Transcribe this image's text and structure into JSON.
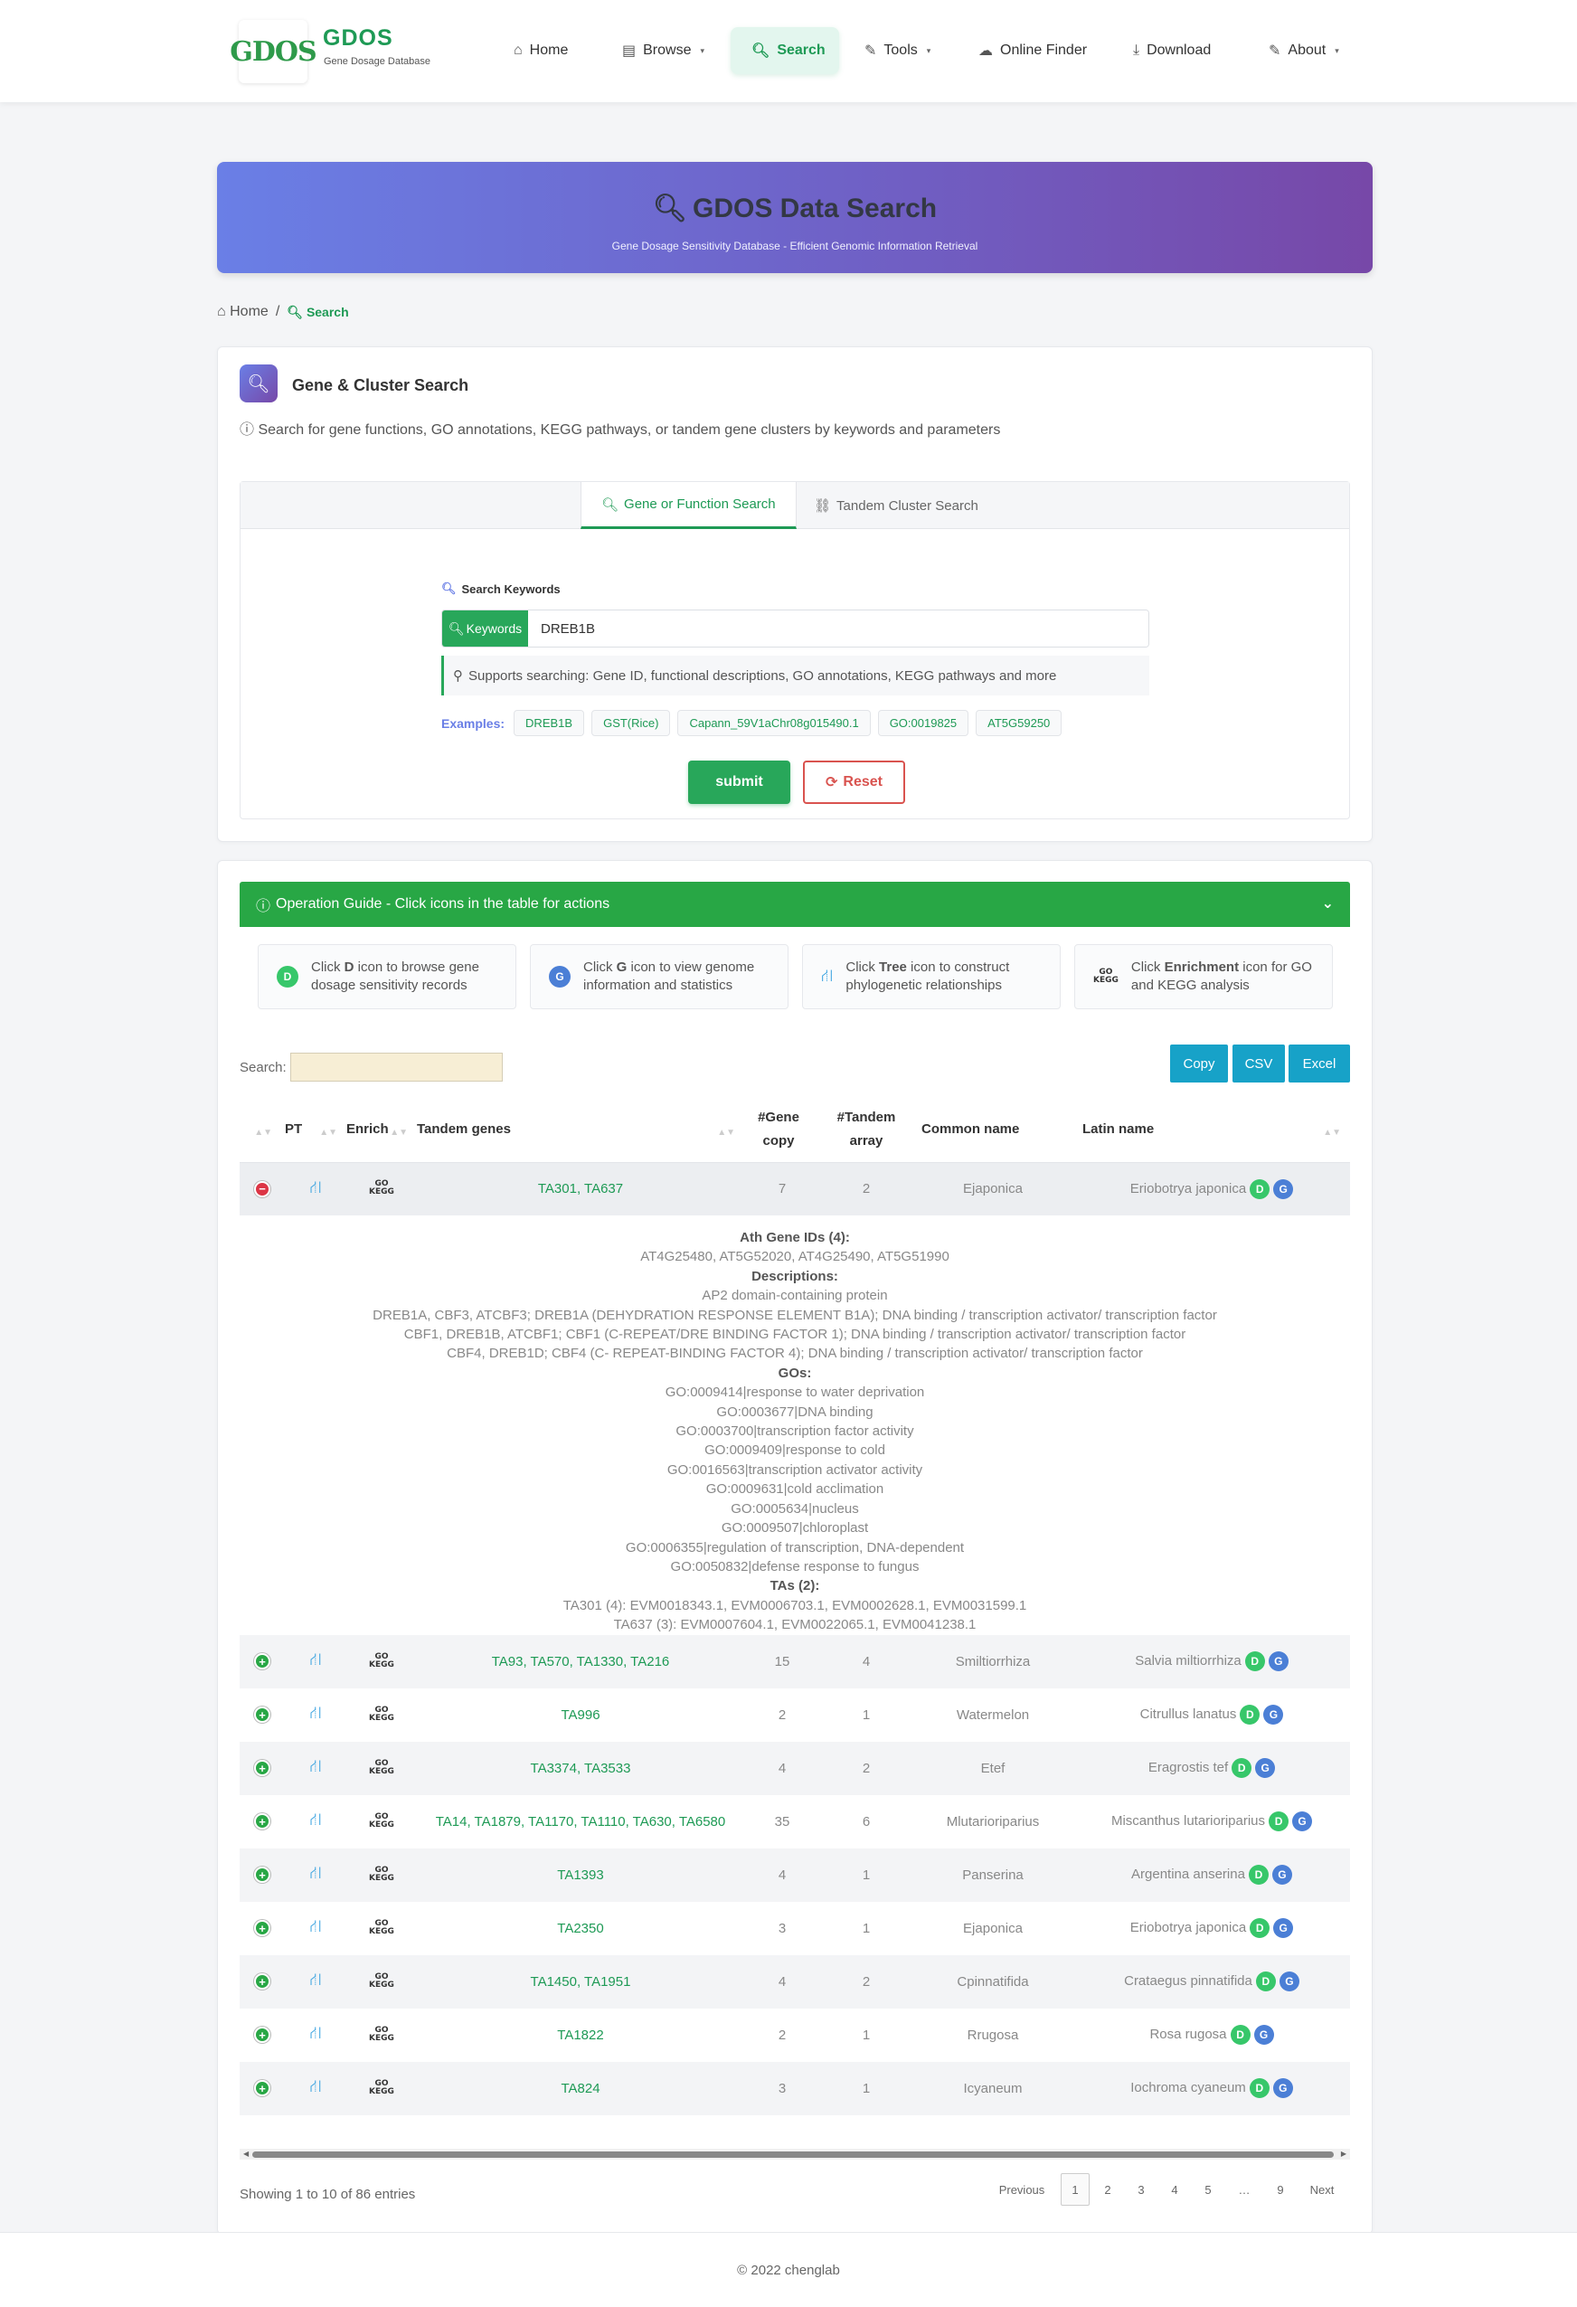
{
  "brand": {
    "logo_text": "GDOS",
    "title": "GDOS",
    "subtitle": "Gene Dosage Database"
  },
  "nav": {
    "items": [
      {
        "label": "Home",
        "icon": "home-icon"
      },
      {
        "label": "Browse",
        "icon": "book-icon"
      },
      {
        "label": "Search",
        "icon": "search-icon"
      },
      {
        "label": "Tools",
        "icon": "wrench-icon"
      },
      {
        "label": "Online Finder",
        "icon": "cloud-icon"
      },
      {
        "label": "Download",
        "icon": "download-icon"
      },
      {
        "label": "About",
        "icon": "wrench-icon"
      }
    ],
    "active": "Search"
  },
  "hero": {
    "title": "GDOS Data Search",
    "subtitle": "Gene Dosage Sensitivity Database - Efficient Genomic Information Retrieval"
  },
  "breadcrumb": {
    "home": "Home",
    "separator": "/",
    "current": "Search"
  },
  "search_card": {
    "title": "Gene & Cluster Search",
    "description": "Search for gene functions, GO annotations, KEGG pathways, or tandem gene clusters by keywords and parameters",
    "tabs": [
      "Gene or Function Search",
      "Tandem Cluster Search"
    ],
    "keyword_label": "Search Keywords",
    "addon_label": "Keywords",
    "keyword_value": "DREB1B",
    "hint": "Supports searching: Gene ID, functional descriptions, GO annotations, KEGG pathways and more",
    "examples_label": "Examples:",
    "examples": [
      "DREB1B",
      "GST(Rice)",
      "Capann_59V1aChr08g015490.1",
      "GO:0019825",
      "AT5G59250"
    ],
    "submit_label": "submit",
    "reset_label": "Reset"
  },
  "guide": {
    "title": "Operation Guide - Click icons in the table for actions",
    "items": [
      {
        "pre": "Click ",
        "bold": "D",
        "post": " icon to browse gene dosage sensitivity records",
        "badge": "D"
      },
      {
        "pre": "Click ",
        "bold": "G",
        "post": " icon to view genome information and statistics",
        "badge": "G"
      },
      {
        "pre": "Click ",
        "bold": "Tree",
        "post": " icon to construct phylogenetic relationships",
        "badge": ""
      },
      {
        "pre": "Click ",
        "bold": "Enrichment",
        "post": " icon for GO and KEGG analysis",
        "badge": ""
      }
    ]
  },
  "table": {
    "search_label": "Search:",
    "export_buttons": [
      "Copy",
      "CSV",
      "Excel"
    ],
    "columns": [
      "",
      "PT",
      "Enrich",
      "Tandem genes",
      "#Gene copy",
      "#Tandem array",
      "Common name",
      "Latin name"
    ],
    "kegg_icon_text": [
      "GO",
      "KEGG"
    ],
    "badges": {
      "d": "D",
      "g": "G"
    },
    "rows": [
      {
        "tandem_genes": "TA301, TA637",
        "gene_copy": "7",
        "tandem_array": "2",
        "common_name": "Ejaponica",
        "latin_name": "Eriobotrya japonica",
        "expanded": true
      },
      {
        "tandem_genes": "TA93, TA570, TA1330, TA216",
        "gene_copy": "15",
        "tandem_array": "4",
        "common_name": "Smiltiorrhiza",
        "latin_name": "Salvia miltiorrhiza",
        "expanded": false
      },
      {
        "tandem_genes": "TA996",
        "gene_copy": "2",
        "tandem_array": "1",
        "common_name": "Watermelon",
        "latin_name": "Citrullus lanatus",
        "expanded": false
      },
      {
        "tandem_genes": "TA3374, TA3533",
        "gene_copy": "4",
        "tandem_array": "2",
        "common_name": "Etef",
        "latin_name": "Eragrostis tef",
        "expanded": false
      },
      {
        "tandem_genes": "TA14, TA1879, TA1170, TA1110, TA630, TA6580",
        "gene_copy": "35",
        "tandem_array": "6",
        "common_name": "Mlutarioriparius",
        "latin_name": "Miscanthus lutarioriparius",
        "expanded": false
      },
      {
        "tandem_genes": "TA1393",
        "gene_copy": "4",
        "tandem_array": "1",
        "common_name": "Panserina",
        "latin_name": "Argentina anserina",
        "expanded": false
      },
      {
        "tandem_genes": "TA2350",
        "gene_copy": "3",
        "tandem_array": "1",
        "common_name": "Ejaponica",
        "latin_name": "Eriobotrya japonica",
        "expanded": false
      },
      {
        "tandem_genes": "TA1450, TA1951",
        "gene_copy": "4",
        "tandem_array": "2",
        "common_name": "Cpinnatifida",
        "latin_name": "Crataegus pinnatifida",
        "expanded": false
      },
      {
        "tandem_genes": "TA1822",
        "gene_copy": "2",
        "tandem_array": "1",
        "common_name": "Rrugosa",
        "latin_name": "Rosa rugosa",
        "expanded": false
      },
      {
        "tandem_genes": "TA824",
        "gene_copy": "3",
        "tandem_array": "1",
        "common_name": "Icyaneum",
        "latin_name": "Iochroma cyaneum",
        "expanded": false
      }
    ],
    "detail_lines": [
      {
        "text": "Ath Gene IDs (4):",
        "heading": true
      },
      {
        "text": "AT4G25480, AT5G52020, AT4G25490, AT5G51990",
        "heading": false
      },
      {
        "text": "Descriptions:",
        "heading": true
      },
      {
        "text": "AP2 domain-containing protein",
        "heading": false
      },
      {
        "text": "DREB1A, CBF3, ATCBF3; DREB1A (DEHYDRATION RESPONSE ELEMENT B1A); DNA binding / transcription activator/ transcription factor",
        "heading": false
      },
      {
        "text": "CBF1, DREB1B, ATCBF1; CBF1 (C-REPEAT/DRE BINDING FACTOR 1); DNA binding / transcription activator/ transcription factor",
        "heading": false
      },
      {
        "text": "CBF4, DREB1D; CBF4 (C- REPEAT-BINDING FACTOR 4); DNA binding / transcription activator/ transcription factor",
        "heading": false
      },
      {
        "text": "GOs:",
        "heading": true
      },
      {
        "text": "GO:0009414|response to water deprivation",
        "heading": false
      },
      {
        "text": "GO:0003677|DNA binding",
        "heading": false
      },
      {
        "text": "GO:0003700|transcription factor activity",
        "heading": false
      },
      {
        "text": "GO:0009409|response to cold",
        "heading": false
      },
      {
        "text": "GO:0016563|transcription activator activity",
        "heading": false
      },
      {
        "text": "GO:0009631|cold acclimation",
        "heading": false
      },
      {
        "text": "GO:0005634|nucleus",
        "heading": false
      },
      {
        "text": "GO:0009507|chloroplast",
        "heading": false
      },
      {
        "text": "GO:0006355|regulation of transcription, DNA-dependent",
        "heading": false
      },
      {
        "text": "GO:0050832|defense response to fungus",
        "heading": false
      },
      {
        "text": "TAs (2):",
        "heading": true
      },
      {
        "text": "TA301 (4): EVM0018343.1, EVM0006703.1, EVM0002628.1, EVM0031599.1",
        "heading": false
      },
      {
        "text": "TA637 (3): EVM0007604.1, EVM0022065.1, EVM0041238.1",
        "heading": false
      }
    ],
    "info": "Showing 1 to 10 of 86 entries",
    "pagination": [
      "Previous",
      "1",
      "2",
      "3",
      "4",
      "5",
      "…",
      "9",
      "Next"
    ],
    "current_page": "1"
  },
  "footer": {
    "text": "© 2022 chenglab"
  },
  "colors": {
    "brand_green": "#1e9a55",
    "button_green": "#28a745",
    "hero_start": "#6a7fe6",
    "hero_end": "#7748a8",
    "export_blue": "#17a2c8",
    "reset_red": "#d9534f",
    "badge_d": "#37c76a",
    "badge_g": "#4b7fd6"
  }
}
